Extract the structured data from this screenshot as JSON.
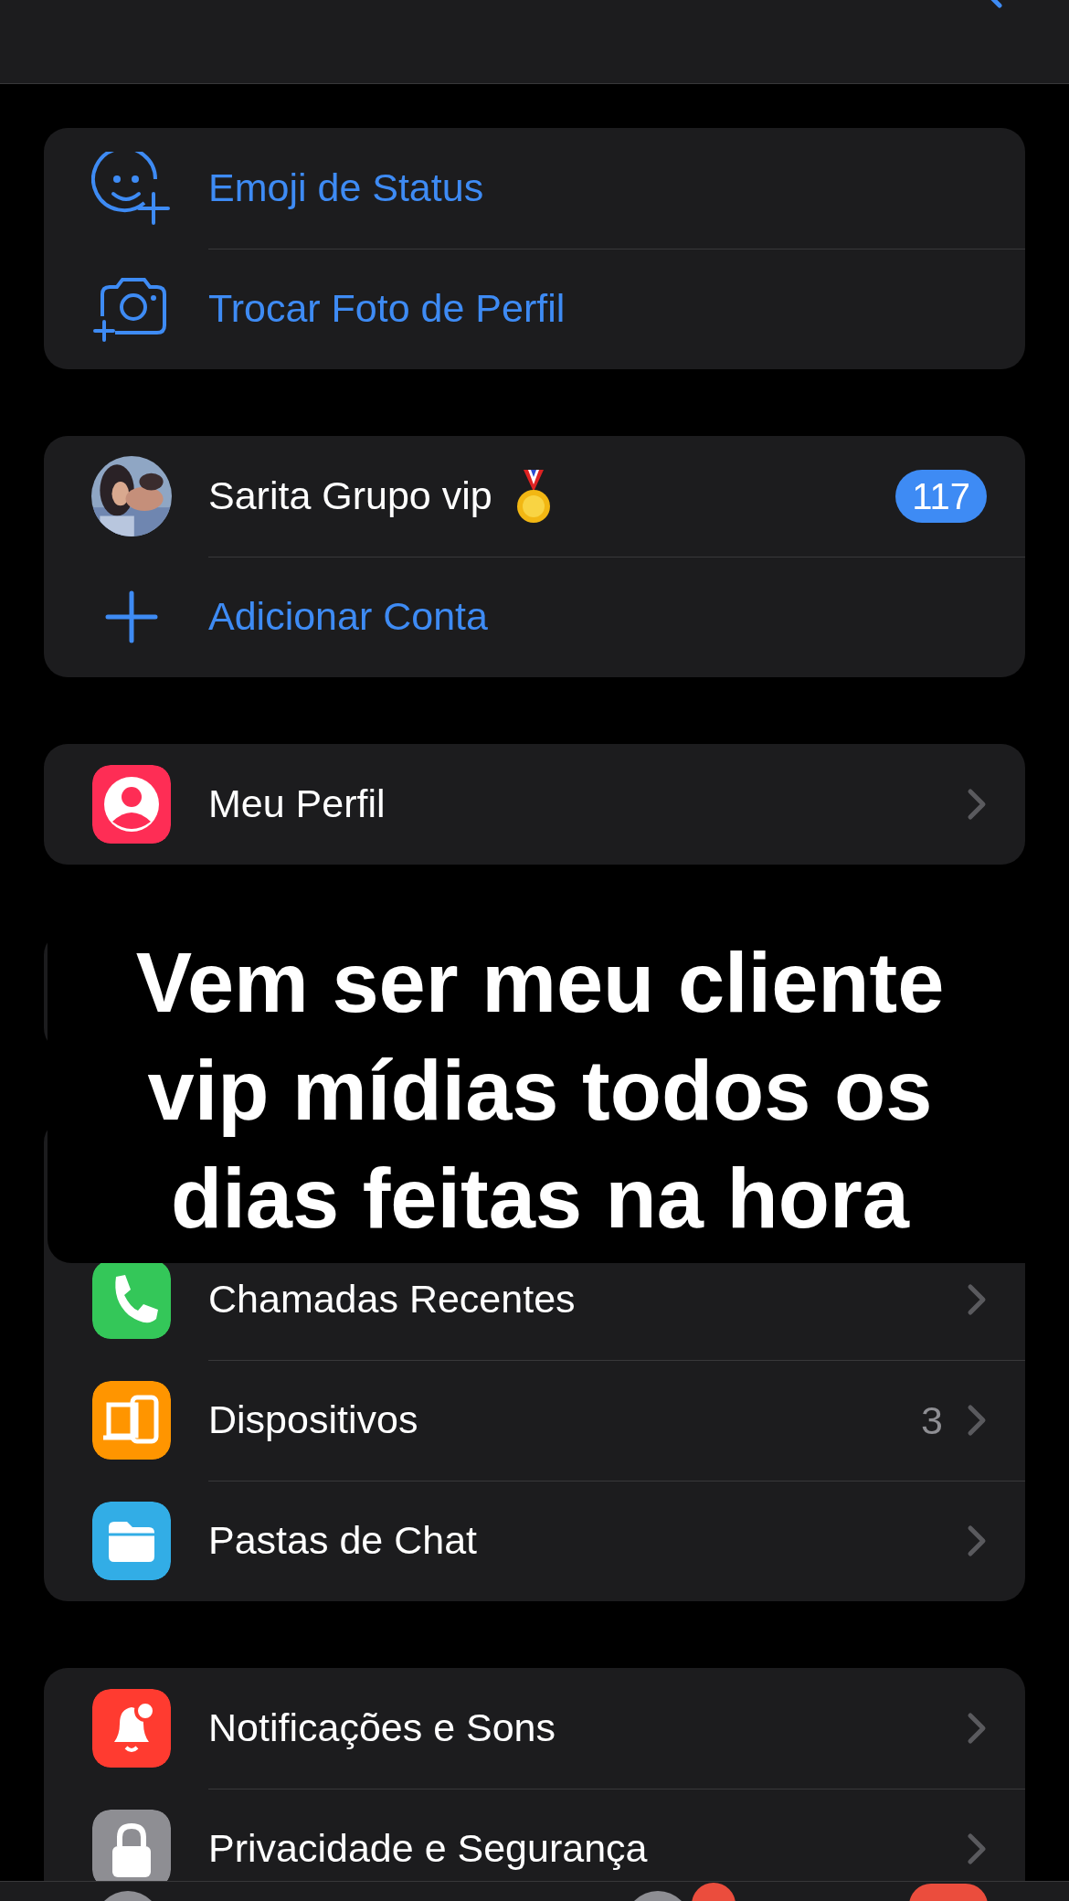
{
  "profile_actions": [
    {
      "kind": "emoji",
      "label": "Emoji de Status"
    },
    {
      "kind": "camera",
      "label": "Trocar Foto de Perfil"
    }
  ],
  "accounts": [
    {
      "kind": "account",
      "name": "Sarita Grupo vip",
      "badge": "117"
    },
    {
      "kind": "add",
      "name": "Adicionar Conta"
    }
  ],
  "menu_groups": [
    {
      "items": [
        {
          "kind": "profile",
          "label": "Meu Perfil"
        }
      ]
    },
    {
      "items": [
        {
          "kind": "calls",
          "label": "Chamadas Recentes"
        },
        {
          "kind": "devices",
          "label": "Dispositivos",
          "value": "3"
        },
        {
          "kind": "folders",
          "label": "Pastas de Chat"
        }
      ]
    },
    {
      "items": [
        {
          "kind": "notifications",
          "label": "Notificações e Sons"
        },
        {
          "kind": "privacy",
          "label": "Privacidade e Segurança"
        }
      ]
    }
  ],
  "caption": "Vem ser meu cliente\nvip mídias todos os\ndias feitas na hora"
}
